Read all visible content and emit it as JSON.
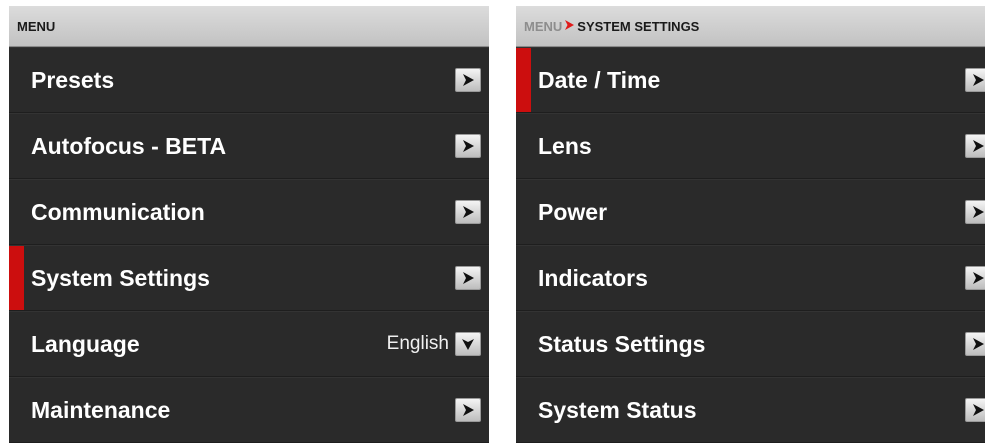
{
  "left_panel": {
    "header": "MENU",
    "items": [
      {
        "label": "Presets",
        "control": "arrow-right-icon"
      },
      {
        "label": "Autofocus - BETA",
        "control": "arrow-right-icon"
      },
      {
        "label": "Communication",
        "control": "arrow-right-icon"
      },
      {
        "label": "System Settings",
        "control": "arrow-right-icon",
        "selected": true
      },
      {
        "label": "Language",
        "value": "English",
        "control": "dropdown-arrow-icon"
      },
      {
        "label": "Maintenance",
        "control": "arrow-right-icon"
      }
    ]
  },
  "right_panel": {
    "breadcrumb": {
      "parent": "MENU",
      "separator": ">",
      "current": "SYSTEM SETTINGS"
    },
    "items": [
      {
        "label": "Date / Time",
        "control": "arrow-right-icon",
        "selected": true
      },
      {
        "label": "Lens",
        "control": "arrow-right-icon"
      },
      {
        "label": "Power",
        "control": "arrow-right-icon"
      },
      {
        "label": "Indicators",
        "control": "arrow-right-icon"
      },
      {
        "label": "Status Settings",
        "control": "arrow-right-icon"
      },
      {
        "label": "System Status",
        "control": "arrow-right-icon"
      }
    ]
  },
  "colors": {
    "background": "#2a2a2a",
    "header": "#d0d0d0",
    "accent": "#cc0e0e",
    "text": "#ffffff"
  }
}
